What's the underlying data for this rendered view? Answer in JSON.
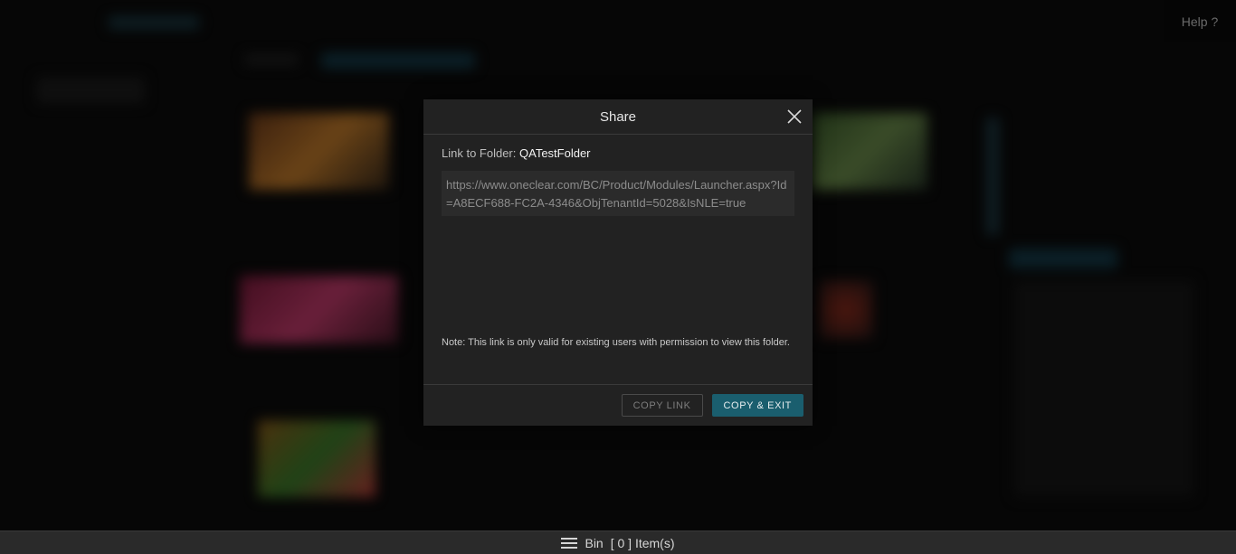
{
  "header": {
    "help_label": "Help ?"
  },
  "modal": {
    "title": "Share",
    "link_prefix": "Link to Folder:",
    "folder_name": "QATestFolder",
    "url": "https://www.oneclear.com/BC/Product/Modules/Launcher.aspx?Id=A8ECF688-FC2A-4346&ObjTenantId=5028&IsNLE=true",
    "note": "Note: This link is only valid for existing users with permission to view this folder.",
    "copy_link_label": "COPY LINK",
    "copy_exit_label": "COPY & EXIT"
  },
  "bin": {
    "label": "Bin",
    "count_text": "[ 0 ] Item(s)"
  },
  "colors": {
    "accent": "#1a5e6e",
    "modal_bg": "#222222",
    "overlay": "#0b0b0b"
  }
}
